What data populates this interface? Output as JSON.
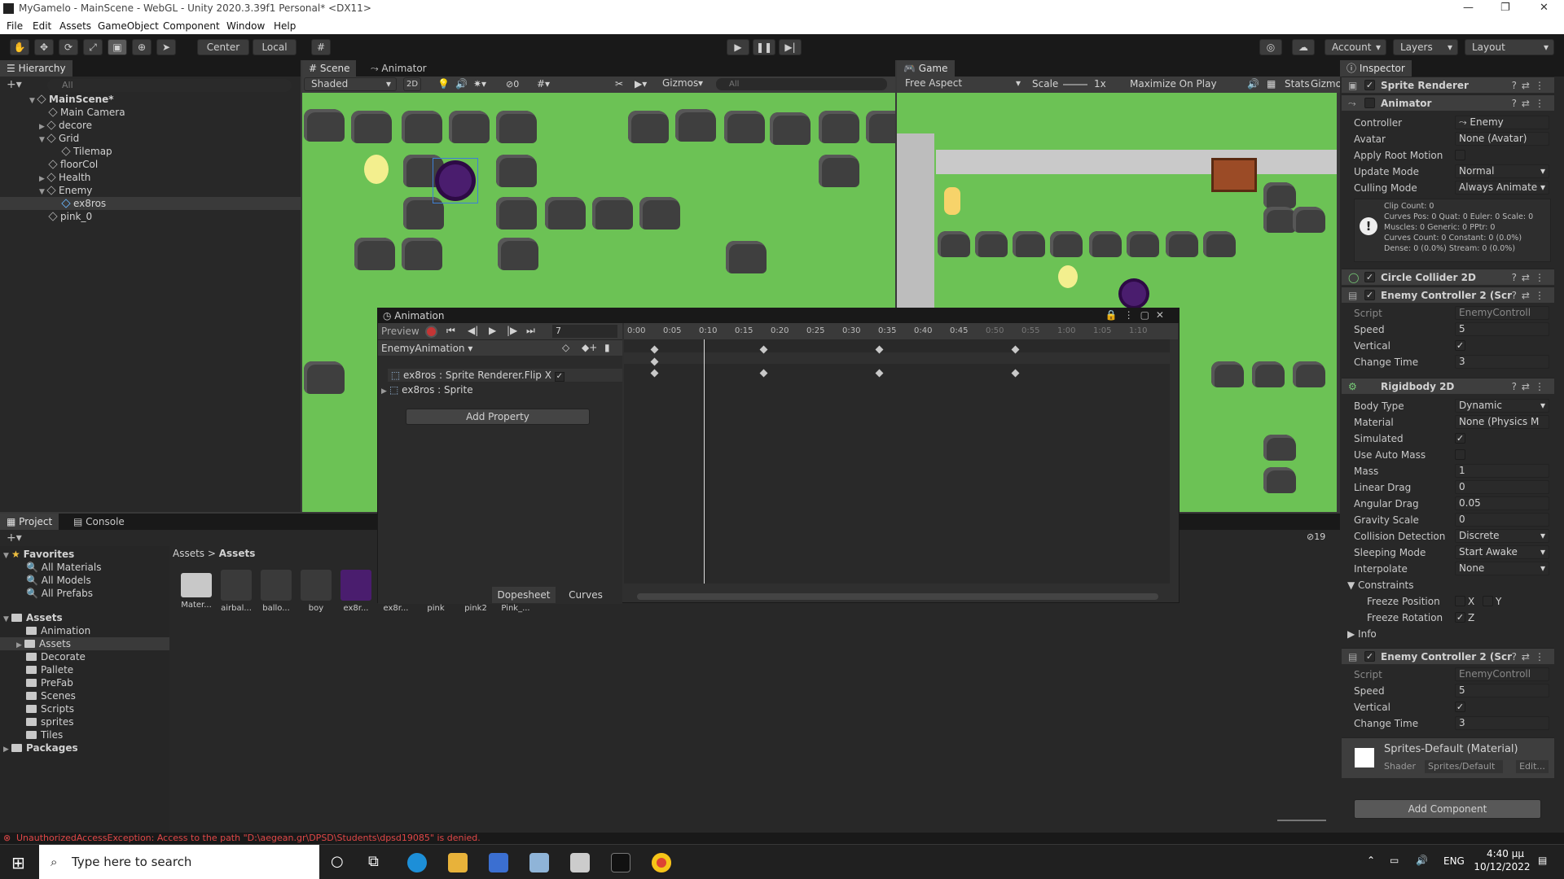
{
  "window": {
    "title": "MyGamelo - MainScene - WebGL - Unity 2020.3.39f1 Personal* <DX11>",
    "min": "—",
    "max": "❐",
    "close": "✕"
  },
  "menu": [
    "File",
    "Edit",
    "Assets",
    "GameObject",
    "Component",
    "Window",
    "Help"
  ],
  "toolbar": {
    "center": "Center",
    "local": "Local",
    "account": "Account",
    "layers": "Layers",
    "layout": "Layout"
  },
  "hierarchy": {
    "tab": "Hierarchy",
    "search_placeholder": "All",
    "items": [
      {
        "label": "MainScene*",
        "indent": 0
      },
      {
        "label": "Main Camera",
        "indent": 1
      },
      {
        "label": "decore",
        "indent": 1
      },
      {
        "label": "Grid",
        "indent": 1
      },
      {
        "label": "Tilemap",
        "indent": 2
      },
      {
        "label": "floorCol",
        "indent": 1
      },
      {
        "label": "Health",
        "indent": 1
      },
      {
        "label": "Enemy",
        "indent": 1
      },
      {
        "label": "ex8ros",
        "indent": 2,
        "selected": true
      },
      {
        "label": "pink_0",
        "indent": 1
      }
    ]
  },
  "scene": {
    "tabs": [
      "Scene",
      "Animator"
    ],
    "shading": "Shaded",
    "mode_2d": "2D",
    "gizmos": "Gizmos",
    "search_placeholder": "All",
    "hidden_count": "0"
  },
  "game": {
    "tab": "Game",
    "aspect": "Free Aspect",
    "scale_label": "Scale",
    "scale_value": "1x",
    "maximize": "Maximize On Play",
    "stats": "Stats",
    "gizmos": "Gizmos"
  },
  "animation": {
    "title": "Animation",
    "preview": "Preview",
    "frame": "7",
    "clip": "EnemyAnimation",
    "properties": [
      "ex8ros : Sprite Renderer.Flip X",
      "ex8ros : Sprite"
    ],
    "add_property": "Add Property",
    "dopesheet": "Dopesheet",
    "curves": "Curves",
    "timeline": [
      "0:00",
      "0:05",
      "0:10",
      "0:15",
      "0:20",
      "0:25",
      "0:30",
      "0:35",
      "0:40",
      "0:45",
      "0:50",
      "0:55",
      "1:00",
      "1:05",
      "1:10"
    ]
  },
  "inspector": {
    "tab": "Inspector",
    "sprite_renderer": "Sprite Renderer",
    "animator": {
      "name": "Animator",
      "controller_label": "Controller",
      "controller": "Enemy",
      "avatar_label": "Avatar",
      "avatar": "None (Avatar)",
      "root_motion_label": "Apply Root Motion",
      "update_label": "Update Mode",
      "update": "Normal",
      "culling_label": "Culling Mode",
      "culling": "Always Animate",
      "info": [
        "Clip Count: 0",
        "Curves Pos: 0 Quat: 0 Euler: 0 Scale: 0",
        "Muscles: 0 Generic: 0 PPtr: 0",
        "Curves Count: 0 Constant: 0 (0.0%)",
        "Dense: 0 (0.0%) Stream: 0 (0.0%)"
      ]
    },
    "circle_collider": "Circle Collider 2D",
    "enemy1": {
      "name": "Enemy Controller 2 (Scr",
      "script_label": "Script",
      "script": "EnemyControll",
      "speed_label": "Speed",
      "speed": "5",
      "vertical_label": "Vertical",
      "change_label": "Change Time",
      "change": "3"
    },
    "rigidbody": {
      "name": "Rigidbody 2D",
      "body_type_label": "Body Type",
      "body_type": "Dynamic",
      "material_label": "Material",
      "material": "None (Physics M",
      "simulated_label": "Simulated",
      "auto_mass_label": "Use Auto Mass",
      "mass_label": "Mass",
      "mass": "1",
      "linear_label": "Linear Drag",
      "linear": "0",
      "angular_label": "Angular Drag",
      "angular": "0.05",
      "gravity_label": "Gravity Scale",
      "gravity": "0",
      "collision_label": "Collision Detection",
      "collision": "Discrete",
      "sleeping_label": "Sleeping Mode",
      "sleeping": "Start Awake",
      "interpolate_label": "Interpolate",
      "interpolate": "None",
      "constraints_label": "Constraints",
      "freeze_pos_label": "Freeze Position",
      "x": "X",
      "y": "Y",
      "freeze_rot_label": "Freeze Rotation",
      "z": "Z",
      "info_label": "Info"
    },
    "enemy2": {
      "name": "Enemy Controller 2 (Scr",
      "script_label": "Script",
      "script": "EnemyControll",
      "speed_label": "Speed",
      "speed": "5",
      "vertical_label": "Vertical",
      "change_label": "Change Time",
      "change": "3"
    },
    "material": {
      "name": "Sprites-Default (Material)",
      "shader_label": "Shader",
      "shader": "Sprites/Default",
      "edit": "Edit..."
    },
    "add_component": "Add Component"
  },
  "project": {
    "tabs": [
      "Project",
      "Console"
    ],
    "favorites_label": "Favorites",
    "favorites": [
      "All Materials",
      "All Models",
      "All Prefabs"
    ],
    "assets_label": "Assets",
    "folders": [
      "Animation",
      "Assets",
      "Decorate",
      "Pallete",
      "PreFab",
      "Scenes",
      "Scripts",
      "sprites",
      "Tiles"
    ],
    "packages_label": "Packages",
    "breadcrumb": [
      "Assets",
      "Assets"
    ],
    "count": "19",
    "items": [
      "Mater...",
      "airbal...",
      "ballo...",
      "boy",
      "ex8r...",
      "ex8r...",
      "pink",
      "pink2",
      "Pink_..."
    ]
  },
  "status": "UnauthorizedAccessException: Access to the path \"D:\\aegean.gr\\DPSD\\Students\\dpsd19085\" is denied.",
  "taskbar": {
    "search": "Type here to search",
    "lang": "ENG",
    "time": "4:40 μμ",
    "date": "10/12/2022"
  }
}
